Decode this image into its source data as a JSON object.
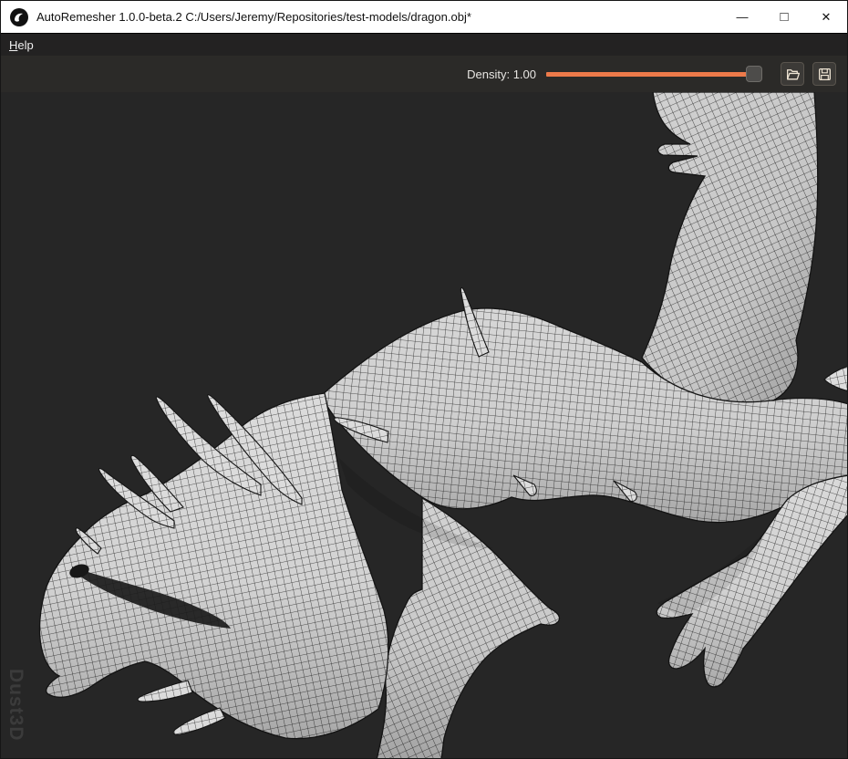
{
  "titlebar": {
    "title": "AutoRemesher 1.0.0-beta.2 C:/Users/Jeremy/Repositories/test-models/dragon.obj*",
    "app_icon": "dust3d-logo",
    "controls": {
      "minimize": "—",
      "maximize": "□",
      "close": "✕"
    }
  },
  "menubar": {
    "items": [
      {
        "label": "Help",
        "mnemonic": "H",
        "rest": "elp"
      }
    ]
  },
  "toolbar": {
    "density_label": "Density:",
    "density_value": "1.00",
    "slider": {
      "value": "1.00",
      "accent_color": "#ed7a4a",
      "handle_color": "#4d4c4a"
    },
    "buttons": [
      {
        "name": "open-model",
        "icon": "folder-open-icon"
      },
      {
        "name": "save-model",
        "icon": "save-icon"
      }
    ]
  },
  "viewport": {
    "watermark": "Dust3D",
    "background_color": "#262626",
    "mesh_surface_color": "#d7d7d7",
    "wireframe_color": "#262626",
    "model_file": "dragon.obj"
  }
}
